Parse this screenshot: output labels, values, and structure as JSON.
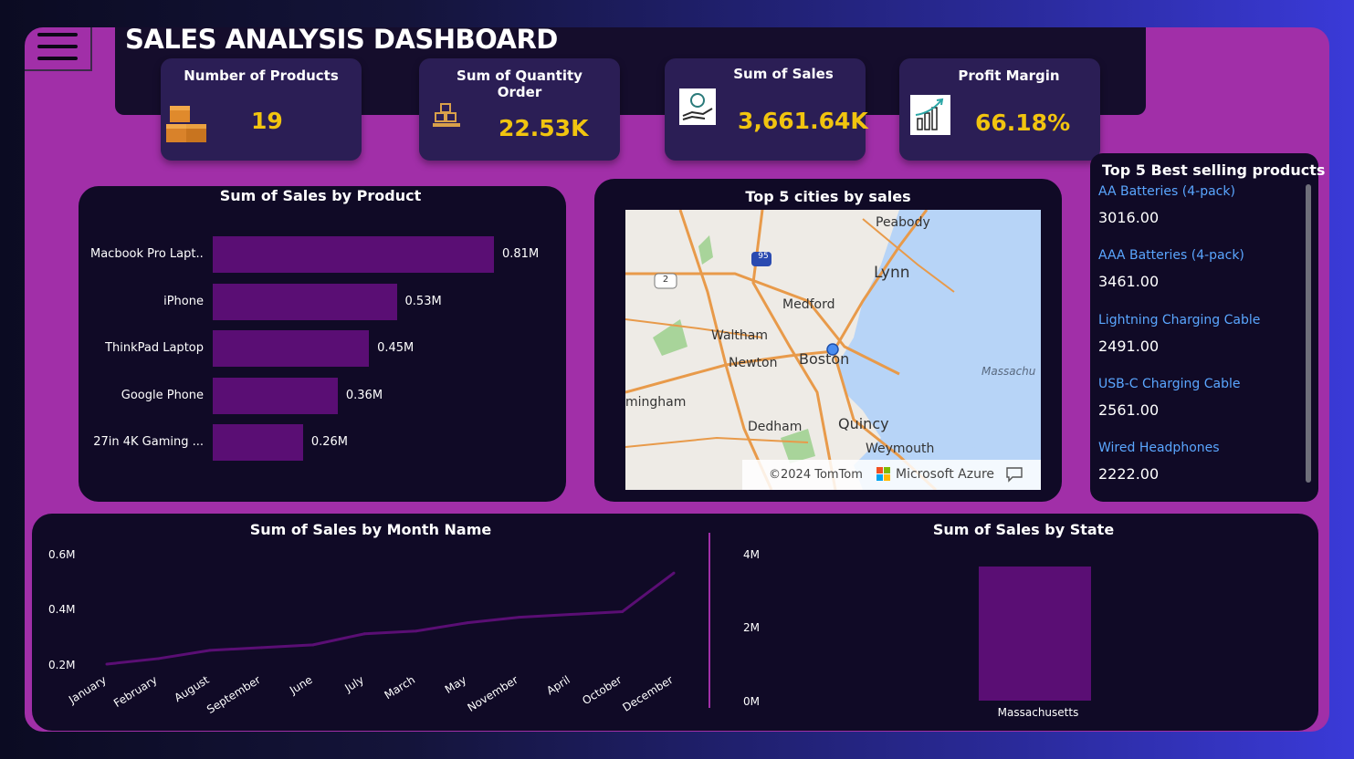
{
  "dashboard": {
    "title": "SALES ANALYSIS DASHBOARD"
  },
  "kpis": [
    {
      "label": "Number of Products",
      "value": "19",
      "icon": "boxes-icon"
    },
    {
      "label": "Sum of Quantity Order",
      "value": "22.53K",
      "icon": "packages-icon"
    },
    {
      "label": "Sum of Sales",
      "value": "3,661.64K",
      "icon": "money-hand-icon"
    },
    {
      "label": "Profit Margin",
      "value": "66.18%",
      "icon": "growth-chart-icon"
    }
  ],
  "product_chart": {
    "title": "Sum of Sales by Product",
    "labels": [
      "Macbook Pro Lapt...",
      "iPhone",
      "ThinkPad Laptop",
      "Google Phone",
      "27in 4K Gaming ..."
    ],
    "value_labels": [
      "0.81M",
      "0.53M",
      "0.45M",
      "0.36M",
      "0.26M"
    ]
  },
  "map": {
    "title": "Top 5 cities by sales",
    "places": [
      "Peabody",
      "Lynn",
      "Medford",
      "Waltham",
      "Newton",
      "Boston",
      "Massachu",
      "mingham",
      "Dedham",
      "Quincy",
      "Weymouth"
    ],
    "route_shields": [
      "95",
      "2"
    ],
    "copyright": "©2024 TomTom",
    "provider": "Microsoft Azure"
  },
  "top5": {
    "title": "Top 5 Best selling products",
    "items": [
      {
        "name": "AA Batteries (4-pack)",
        "value": "3016.00"
      },
      {
        "name": "AAA Batteries (4-pack)",
        "value": "3461.00"
      },
      {
        "name": "Lightning Charging Cable",
        "value": "2491.00"
      },
      {
        "name": "USB-C Charging Cable",
        "value": "2561.00"
      },
      {
        "name": "Wired Headphones",
        "value": "2222.00"
      }
    ]
  },
  "month_chart": {
    "title": "Sum of Sales by Month Name",
    "y_ticks": [
      "0.6M",
      "0.4M",
      "0.2M"
    ]
  },
  "state_chart": {
    "title": "Sum of Sales by State",
    "y_ticks": [
      "4M",
      "2M",
      "0M"
    ]
  },
  "colors": {
    "kpi_value": "#f1c40f",
    "bar": "#5a0e74",
    "accent_frame": "#a12fa8",
    "line": "#5a0e74",
    "link": "#5aa6ff"
  },
  "chart_data": [
    {
      "type": "bar",
      "orientation": "horizontal",
      "title": "Sum of Sales by Product",
      "categories": [
        "Macbook Pro Lapt...",
        "iPhone",
        "ThinkPad Laptop",
        "Google Phone",
        "27in 4K Gaming ..."
      ],
      "values": [
        0.81,
        0.53,
        0.45,
        0.36,
        0.26
      ],
      "unit": "M"
    },
    {
      "type": "line",
      "title": "Sum of Sales by Month Name",
      "categories": [
        "January",
        "February",
        "August",
        "September",
        "June",
        "July",
        "March",
        "May",
        "November",
        "April",
        "October",
        "December"
      ],
      "values": [
        0.2,
        0.22,
        0.25,
        0.26,
        0.27,
        0.31,
        0.32,
        0.35,
        0.37,
        0.38,
        0.39,
        0.53
      ],
      "ylim": [
        0.2,
        0.6
      ],
      "y_ticks": [
        0.2,
        0.4,
        0.6
      ],
      "unit": "M"
    },
    {
      "type": "bar",
      "title": "Sum of Sales by State",
      "categories": [
        "Massachusetts"
      ],
      "values": [
        3.66
      ],
      "ylim": [
        0,
        4
      ],
      "y_ticks": [
        0,
        2,
        4
      ],
      "unit": "M"
    }
  ]
}
